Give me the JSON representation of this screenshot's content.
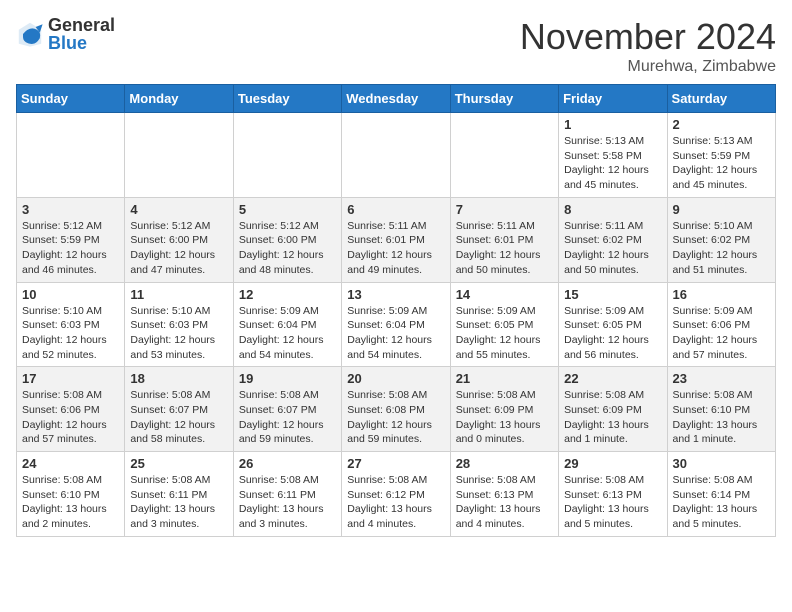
{
  "header": {
    "logo_general": "General",
    "logo_blue": "Blue",
    "month_title": "November 2024",
    "location": "Murehwa, Zimbabwe"
  },
  "days_of_week": [
    "Sunday",
    "Monday",
    "Tuesday",
    "Wednesday",
    "Thursday",
    "Friday",
    "Saturday"
  ],
  "weeks": [
    [
      {
        "day": "",
        "info": ""
      },
      {
        "day": "",
        "info": ""
      },
      {
        "day": "",
        "info": ""
      },
      {
        "day": "",
        "info": ""
      },
      {
        "day": "",
        "info": ""
      },
      {
        "day": "1",
        "info": "Sunrise: 5:13 AM\nSunset: 5:58 PM\nDaylight: 12 hours\nand 45 minutes."
      },
      {
        "day": "2",
        "info": "Sunrise: 5:13 AM\nSunset: 5:59 PM\nDaylight: 12 hours\nand 45 minutes."
      }
    ],
    [
      {
        "day": "3",
        "info": "Sunrise: 5:12 AM\nSunset: 5:59 PM\nDaylight: 12 hours\nand 46 minutes."
      },
      {
        "day": "4",
        "info": "Sunrise: 5:12 AM\nSunset: 6:00 PM\nDaylight: 12 hours\nand 47 minutes."
      },
      {
        "day": "5",
        "info": "Sunrise: 5:12 AM\nSunset: 6:00 PM\nDaylight: 12 hours\nand 48 minutes."
      },
      {
        "day": "6",
        "info": "Sunrise: 5:11 AM\nSunset: 6:01 PM\nDaylight: 12 hours\nand 49 minutes."
      },
      {
        "day": "7",
        "info": "Sunrise: 5:11 AM\nSunset: 6:01 PM\nDaylight: 12 hours\nand 50 minutes."
      },
      {
        "day": "8",
        "info": "Sunrise: 5:11 AM\nSunset: 6:02 PM\nDaylight: 12 hours\nand 50 minutes."
      },
      {
        "day": "9",
        "info": "Sunrise: 5:10 AM\nSunset: 6:02 PM\nDaylight: 12 hours\nand 51 minutes."
      }
    ],
    [
      {
        "day": "10",
        "info": "Sunrise: 5:10 AM\nSunset: 6:03 PM\nDaylight: 12 hours\nand 52 minutes."
      },
      {
        "day": "11",
        "info": "Sunrise: 5:10 AM\nSunset: 6:03 PM\nDaylight: 12 hours\nand 53 minutes."
      },
      {
        "day": "12",
        "info": "Sunrise: 5:09 AM\nSunset: 6:04 PM\nDaylight: 12 hours\nand 54 minutes."
      },
      {
        "day": "13",
        "info": "Sunrise: 5:09 AM\nSunset: 6:04 PM\nDaylight: 12 hours\nand 54 minutes."
      },
      {
        "day": "14",
        "info": "Sunrise: 5:09 AM\nSunset: 6:05 PM\nDaylight: 12 hours\nand 55 minutes."
      },
      {
        "day": "15",
        "info": "Sunrise: 5:09 AM\nSunset: 6:05 PM\nDaylight: 12 hours\nand 56 minutes."
      },
      {
        "day": "16",
        "info": "Sunrise: 5:09 AM\nSunset: 6:06 PM\nDaylight: 12 hours\nand 57 minutes."
      }
    ],
    [
      {
        "day": "17",
        "info": "Sunrise: 5:08 AM\nSunset: 6:06 PM\nDaylight: 12 hours\nand 57 minutes."
      },
      {
        "day": "18",
        "info": "Sunrise: 5:08 AM\nSunset: 6:07 PM\nDaylight: 12 hours\nand 58 minutes."
      },
      {
        "day": "19",
        "info": "Sunrise: 5:08 AM\nSunset: 6:07 PM\nDaylight: 12 hours\nand 59 minutes."
      },
      {
        "day": "20",
        "info": "Sunrise: 5:08 AM\nSunset: 6:08 PM\nDaylight: 12 hours\nand 59 minutes."
      },
      {
        "day": "21",
        "info": "Sunrise: 5:08 AM\nSunset: 6:09 PM\nDaylight: 13 hours\nand 0 minutes."
      },
      {
        "day": "22",
        "info": "Sunrise: 5:08 AM\nSunset: 6:09 PM\nDaylight: 13 hours\nand 1 minute."
      },
      {
        "day": "23",
        "info": "Sunrise: 5:08 AM\nSunset: 6:10 PM\nDaylight: 13 hours\nand 1 minute."
      }
    ],
    [
      {
        "day": "24",
        "info": "Sunrise: 5:08 AM\nSunset: 6:10 PM\nDaylight: 13 hours\nand 2 minutes."
      },
      {
        "day": "25",
        "info": "Sunrise: 5:08 AM\nSunset: 6:11 PM\nDaylight: 13 hours\nand 3 minutes."
      },
      {
        "day": "26",
        "info": "Sunrise: 5:08 AM\nSunset: 6:11 PM\nDaylight: 13 hours\nand 3 minutes."
      },
      {
        "day": "27",
        "info": "Sunrise: 5:08 AM\nSunset: 6:12 PM\nDaylight: 13 hours\nand 4 minutes."
      },
      {
        "day": "28",
        "info": "Sunrise: 5:08 AM\nSunset: 6:13 PM\nDaylight: 13 hours\nand 4 minutes."
      },
      {
        "day": "29",
        "info": "Sunrise: 5:08 AM\nSunset: 6:13 PM\nDaylight: 13 hours\nand 5 minutes."
      },
      {
        "day": "30",
        "info": "Sunrise: 5:08 AM\nSunset: 6:14 PM\nDaylight: 13 hours\nand 5 minutes."
      }
    ]
  ]
}
